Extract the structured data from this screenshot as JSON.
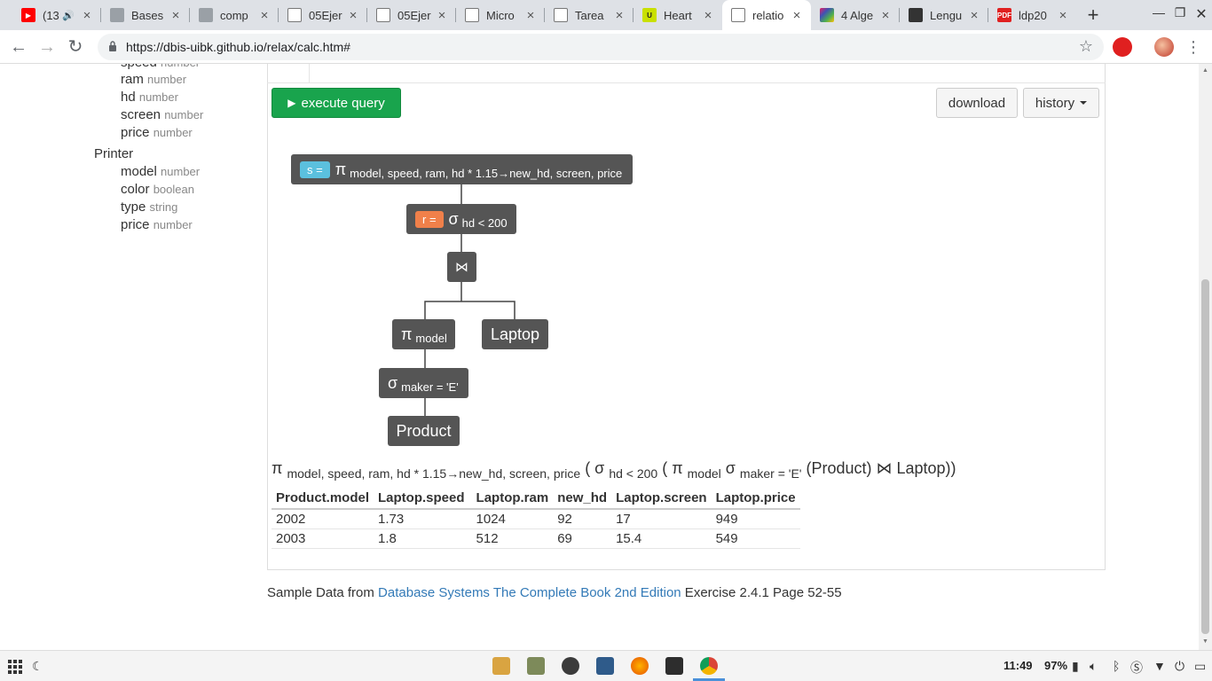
{
  "tabs": [
    {
      "title": "(13",
      "icon": "youtube-icon",
      "color": "#ff0000",
      "extra": "🔊"
    },
    {
      "title": "Bases",
      "icon": "page-thumbnail-icon",
      "color": "#888888"
    },
    {
      "title": "comp",
      "icon": "page-thumbnail-icon",
      "color": "#888888"
    },
    {
      "title": "05Ejer",
      "icon": "document-icon",
      "color": "#777777"
    },
    {
      "title": "05Ejer",
      "icon": "document-icon",
      "color": "#777777"
    },
    {
      "title": "Micro",
      "icon": "document-icon",
      "color": "#777777"
    },
    {
      "title": "Tarea",
      "icon": "document-icon",
      "color": "#777777"
    },
    {
      "title": "Heart",
      "icon": "heart-site-icon",
      "color": "#c9e000"
    },
    {
      "title": "relatio",
      "icon": "document-icon",
      "color": "#777777",
      "active": true
    },
    {
      "title": "4 Alge",
      "icon": "colorful-grid-icon",
      "color": "#9c27b0"
    },
    {
      "title": "Lengu",
      "icon": "dark-site-icon",
      "color": "#333333"
    },
    {
      "title": "ldp20",
      "icon": "pdf-icon",
      "color": "#e02020",
      "badge": "PDF"
    }
  ],
  "browser": {
    "url": "https://dbis-uibk.github.io/relax/calc.htm#"
  },
  "schema": {
    "laptop_attrs": [
      {
        "name": "speed",
        "type": "number"
      },
      {
        "name": "ram",
        "type": "number"
      },
      {
        "name": "hd",
        "type": "number"
      },
      {
        "name": "screen",
        "type": "number"
      },
      {
        "name": "price",
        "type": "number"
      }
    ],
    "printer": {
      "name": "Printer",
      "attrs": [
        {
          "name": "model",
          "type": "number"
        },
        {
          "name": "color",
          "type": "boolean"
        },
        {
          "name": "type",
          "type": "string"
        },
        {
          "name": "price",
          "type": "number"
        }
      ]
    }
  },
  "buttons": {
    "execute": "execute query",
    "download": "download",
    "history": "history"
  },
  "tree": {
    "s_var": "s =",
    "s_sym": "π",
    "s_sub": "model, speed, ram, hd * 1.15→new_hd, screen, price",
    "r_var": "r =",
    "r_sym": "σ",
    "r_sub": "hd < 200",
    "join": "⋈",
    "proj_sym": "π",
    "proj_sub": "model",
    "laptop": "Laptop",
    "sel_sym": "σ",
    "sel_sub": "maker = 'E'",
    "product": "Product",
    "s_color": "#5bc0de",
    "r_color": "#f0804a"
  },
  "formula": {
    "p1": "π",
    "s1": "model, speed, ram, hd * 1.15→new_hd, screen, price",
    "p2": " ( σ",
    "s2": "hd < 200",
    "p3": " ( π",
    "s3": "model",
    "p4": " σ",
    "s4": "maker = 'E'",
    "p5": " (Product) ⋈ Laptop))"
  },
  "result": {
    "columns": [
      "Product.model",
      "Laptop.speed",
      "Laptop.ram",
      "new_hd",
      "Laptop.screen",
      "Laptop.price"
    ],
    "rows": [
      [
        "2002",
        "1.73",
        "1024",
        "92",
        "17",
        "949"
      ],
      [
        "2003",
        "1.8",
        "512",
        "69",
        "15.4",
        "549"
      ]
    ]
  },
  "footer": {
    "prefix": "Sample Data from ",
    "link": "Database Systems The Complete Book 2nd Edition",
    "suffix": " Exercise 2.4.1 Page 52-55"
  },
  "taskbar": {
    "time": "11:49",
    "battery": "97%"
  }
}
